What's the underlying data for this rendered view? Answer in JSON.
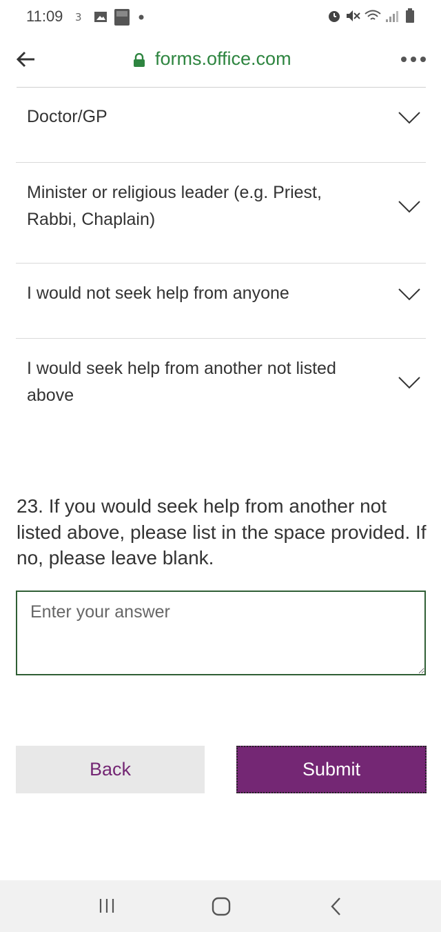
{
  "status_bar": {
    "time": "11:09",
    "carrier_mark": "3"
  },
  "browser": {
    "url": "forms.office.com"
  },
  "options": [
    {
      "label": "Doctor/GP"
    },
    {
      "label": "Minister or religious leader (e.g. Priest, Rabbi, Chaplain)"
    },
    {
      "label": "I would not seek help from anyone"
    },
    {
      "label": "I would seek help from another not listed above"
    }
  ],
  "question": {
    "title": "23. If you would seek help from another not listed above, please list in the space provided. If no, please leave blank.",
    "placeholder": "Enter your answer",
    "value": ""
  },
  "buttons": {
    "back": "Back",
    "submit": "Submit"
  },
  "colors": {
    "brand": "#742774",
    "url_green": "#2e8540",
    "input_border": "#2f5e34"
  },
  "icons": {
    "back": "back-arrow-icon",
    "lock": "lock-icon",
    "more": "more-dots-icon",
    "chevron": "chevron-down-icon",
    "recents": "recent-apps-icon",
    "home": "home-icon",
    "nav_back": "nav-back-icon"
  }
}
